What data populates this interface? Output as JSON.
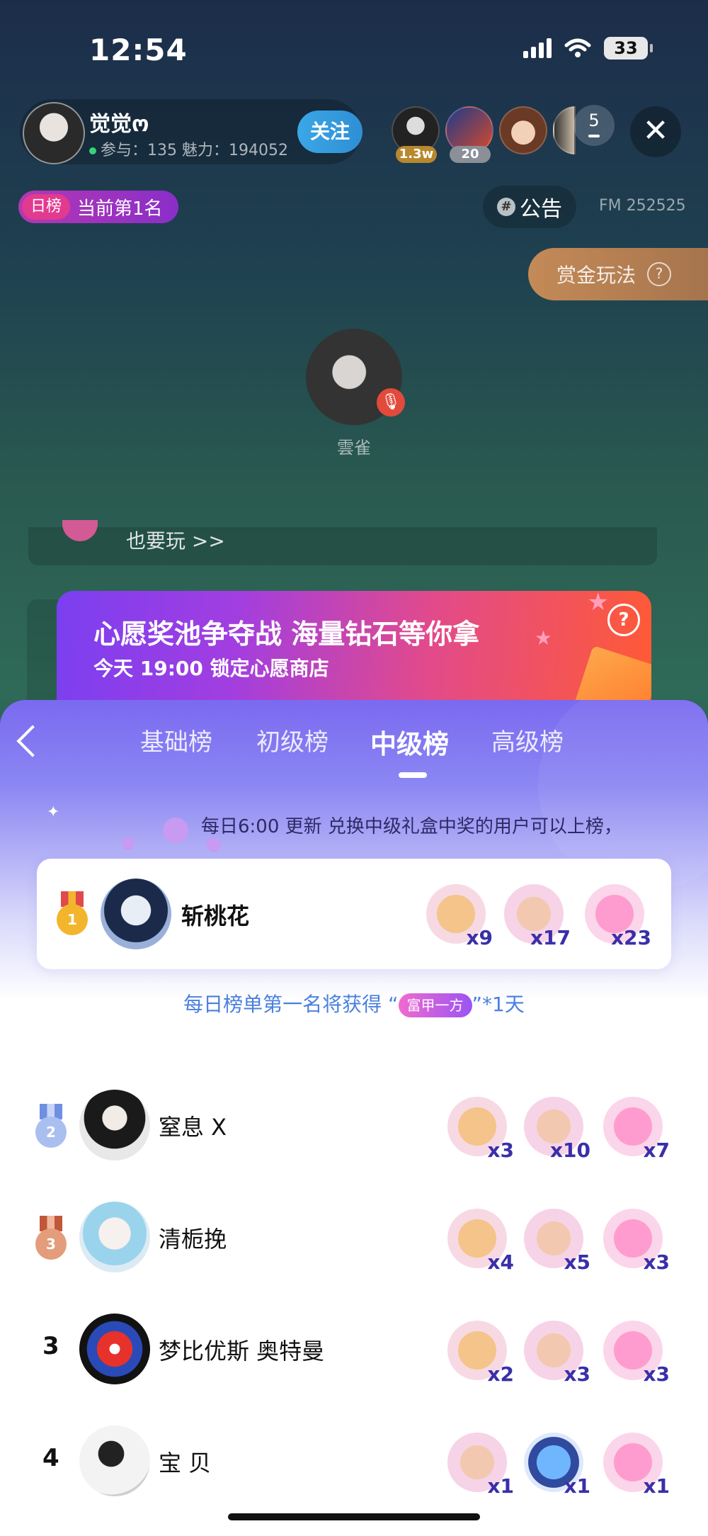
{
  "status_bar": {
    "time": "12:54",
    "battery": "33"
  },
  "host": {
    "name": "觉觉ო",
    "stats": "参与：135 魅力：194052",
    "follow_label": "关注"
  },
  "viewers": {
    "badges": [
      "1.3w",
      "20"
    ],
    "more_count": "5",
    "close_symbol": "✕"
  },
  "room": {
    "daily_rank_tag": "日榜",
    "daily_rank_text": "当前第1名",
    "notice_label": "公告",
    "fm_id": "FM 252525",
    "bounty_label": "赏金玩法",
    "seat_name": "雲雀",
    "game_strip_text": "也要玩 >>"
  },
  "promo": {
    "title": "心愿奖池争夺战 海量钻石等你拿",
    "subtitle": "今天 19:00 锁定心愿商店",
    "help": "?"
  },
  "panel": {
    "tabs": [
      {
        "label": "基础榜",
        "active": false
      },
      {
        "label": "初级榜",
        "active": false
      },
      {
        "label": "中级榜",
        "active": true
      },
      {
        "label": "高级榜",
        "active": false
      }
    ],
    "update_note": "每日6:00 更新 兑换中级礼盒中奖的用户可以上榜，",
    "first": {
      "rank": "1",
      "name": "斩桃花",
      "gifts": [
        {
          "icon": "envelope-bear-icon",
          "count": "x9"
        },
        {
          "icon": "teddy-bear-icon",
          "count": "x17"
        },
        {
          "icon": "heart-wand-icon",
          "count": "x23"
        }
      ]
    },
    "reward_note_prefix": "每日榜单第一名将获得 “",
    "reward_badge": "富甲一方",
    "reward_note_suffix": "”*1天",
    "rows": [
      {
        "rank": "2",
        "name": "窒息 X",
        "gifts": [
          {
            "icon": "envelope-bear-icon",
            "count": "x3"
          },
          {
            "icon": "teddy-bear-icon",
            "count": "x10"
          },
          {
            "icon": "heart-wand-icon",
            "count": "x7"
          }
        ]
      },
      {
        "rank": "3",
        "name": "清栀挽",
        "gifts": [
          {
            "icon": "envelope-bear-icon",
            "count": "x4"
          },
          {
            "icon": "teddy-bear-icon",
            "count": "x5"
          },
          {
            "icon": "heart-wand-icon",
            "count": "x3"
          }
        ]
      },
      {
        "rank": "3",
        "name": "梦比优斯 奥特曼",
        "gifts": [
          {
            "icon": "envelope-bear-icon",
            "count": "x2"
          },
          {
            "icon": "teddy-bear-icon",
            "count": "x3"
          },
          {
            "icon": "heart-wand-icon",
            "count": "x3"
          }
        ]
      },
      {
        "rank": "4",
        "name": "宝 贝",
        "gifts": [
          {
            "icon": "teddy-bear-icon",
            "count": "x1"
          },
          {
            "icon": "magic-book-icon",
            "count": "x1"
          },
          {
            "icon": "heart-wand-icon",
            "count": "x1"
          }
        ]
      }
    ]
  },
  "colors": {
    "gold": "#f2b52c",
    "silver": "#8ea8e8",
    "bronze": "#d98a63",
    "count": "#3a2fa8",
    "accent_blue": "#4a7fe0"
  }
}
